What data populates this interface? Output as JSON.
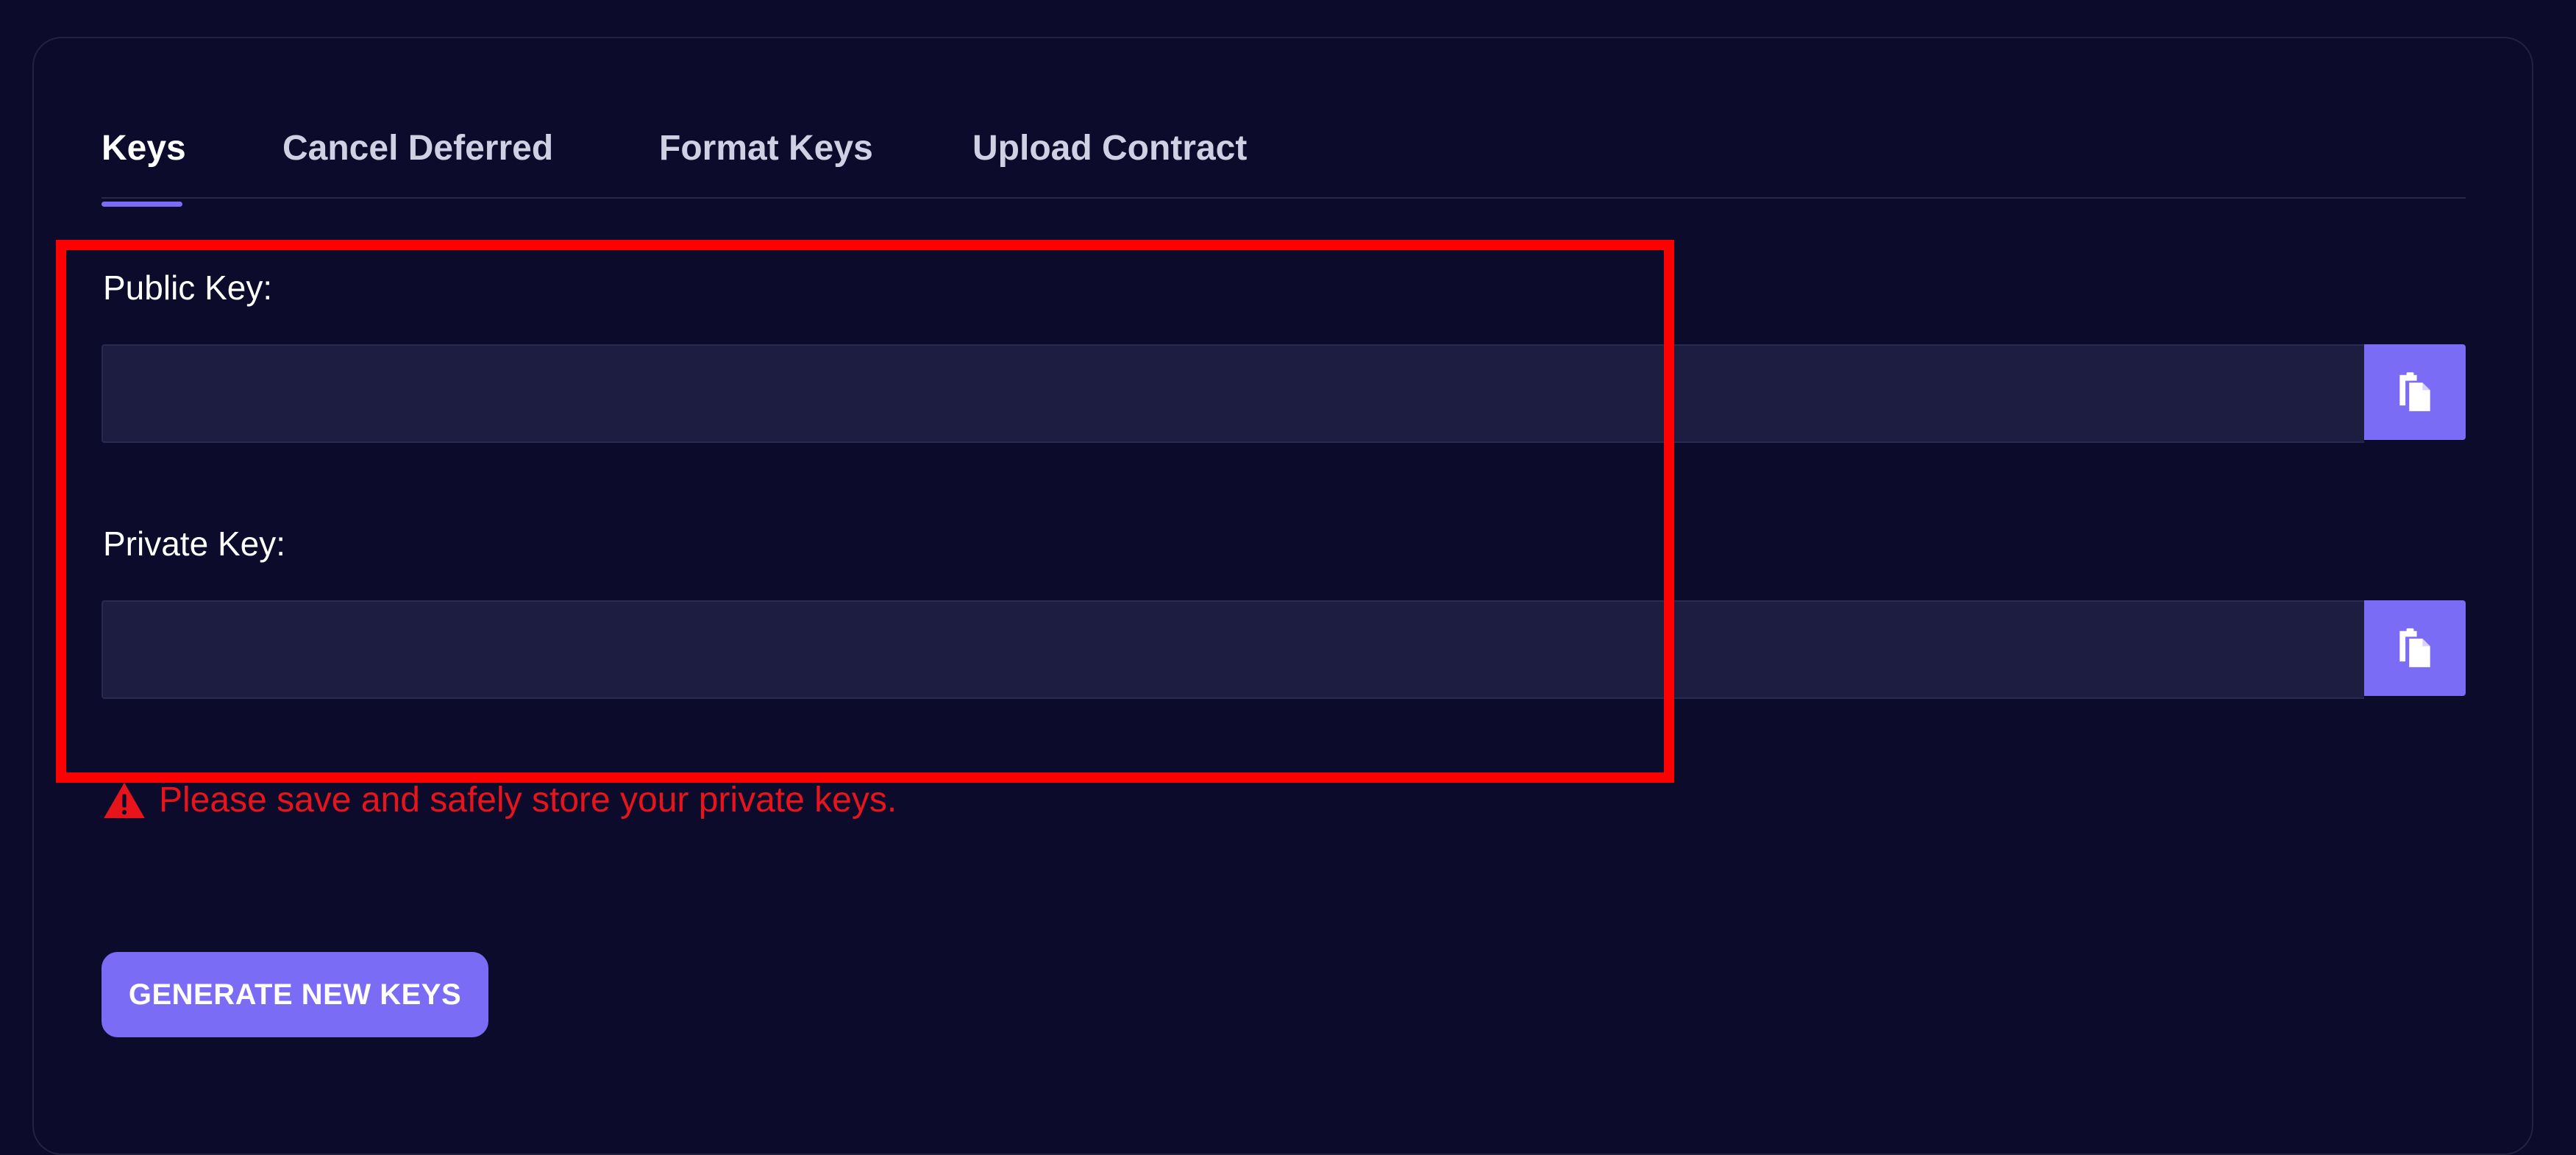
{
  "tabs": [
    {
      "label": "Keys",
      "active": true
    },
    {
      "label": "Cancel Deferred",
      "active": false
    },
    {
      "label": "Format Keys",
      "active": false
    },
    {
      "label": "Upload Contract",
      "active": false
    }
  ],
  "public_key": {
    "label": "Public Key:",
    "value": "",
    "copy_icon": "copy-icon"
  },
  "private_key": {
    "label": "Private Key:",
    "value": "",
    "copy_icon": "copy-icon"
  },
  "warning": {
    "icon": "warning-icon",
    "text": "Please save and safely store your private keys."
  },
  "generate_button": {
    "label": "GENERATE NEW KEYS"
  },
  "colors": {
    "background": "#0c0b2b",
    "input_background": "#1d1c41",
    "accent": "#7b6cf6",
    "warning": "#e8141c",
    "highlight": "#ff0000"
  }
}
